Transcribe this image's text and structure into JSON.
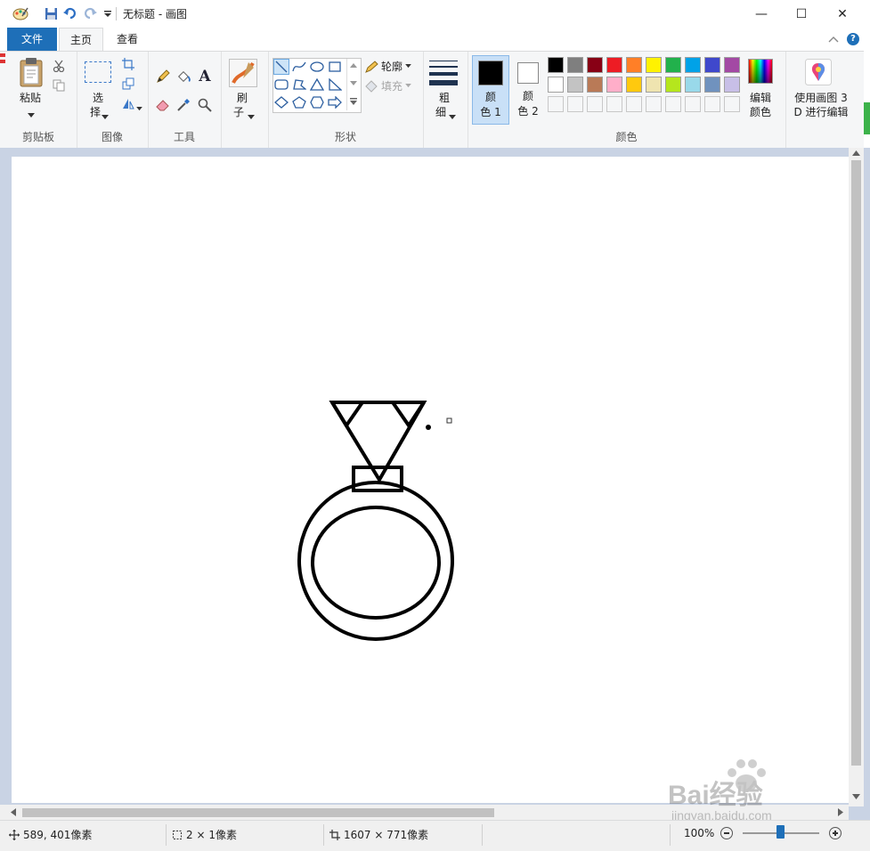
{
  "window": {
    "title": "无标题 - 画图",
    "minimize": "—",
    "maximize": "☐",
    "close": "✕"
  },
  "quick_access": [
    "app-icon",
    "save-icon",
    "undo-icon",
    "redo-icon",
    "customize-dropdown-icon"
  ],
  "tabs": {
    "file": "文件",
    "home": "主页",
    "view": "查看"
  },
  "ribbon": {
    "clipboard": {
      "paste": "粘贴",
      "group": "剪贴板"
    },
    "image": {
      "select_1": "选",
      "select_2": "择",
      "group": "图像"
    },
    "tools": {
      "group": "工具",
      "text_tool": "A"
    },
    "brushes": {
      "label_1": "刷",
      "label_2": "子"
    },
    "shapes": {
      "outline": "轮廓",
      "fill": "填充",
      "group": "形状"
    },
    "size": {
      "label_1": "粗",
      "label_2": "细"
    },
    "color1": {
      "label_1": "颜",
      "label_2": "色 1"
    },
    "color2": {
      "label_1": "颜",
      "label_2": "色 2"
    },
    "colors": {
      "group": "颜色",
      "row1": [
        "#000000",
        "#7f7f7f",
        "#880015",
        "#ed1c24",
        "#ff7f27",
        "#fff200",
        "#22b14c",
        "#00a2e8",
        "#3f48cc",
        "#a349a4"
      ],
      "row2": [
        "#ffffff",
        "#c3c3c3",
        "#b97a57",
        "#ffaec9",
        "#ffc90e",
        "#efe4b0",
        "#b5e61d",
        "#99d9ea",
        "#7092be",
        "#c8bfe7"
      ],
      "row3": [
        "#f5f6f7",
        "#f5f6f7",
        "#f5f6f7",
        "#f5f6f7",
        "#f5f6f7",
        "#f5f6f7",
        "#f5f6f7",
        "#f5f6f7",
        "#f5f6f7",
        "#f5f6f7"
      ],
      "edit_1": "编辑",
      "edit_2": "颜色"
    },
    "paint3d": {
      "label_1": "使用画图 3",
      "label_2": "D 进行编辑"
    }
  },
  "status": {
    "cursor_pos": "589, 401像素",
    "selection_size": "2 × 1像素",
    "image_size": "1607 × 771像素",
    "zoom": "100%"
  },
  "watermark": {
    "brand": "Bai经验",
    "url": "jingyan.baidu.com"
  },
  "accent": "#1e6fb8"
}
